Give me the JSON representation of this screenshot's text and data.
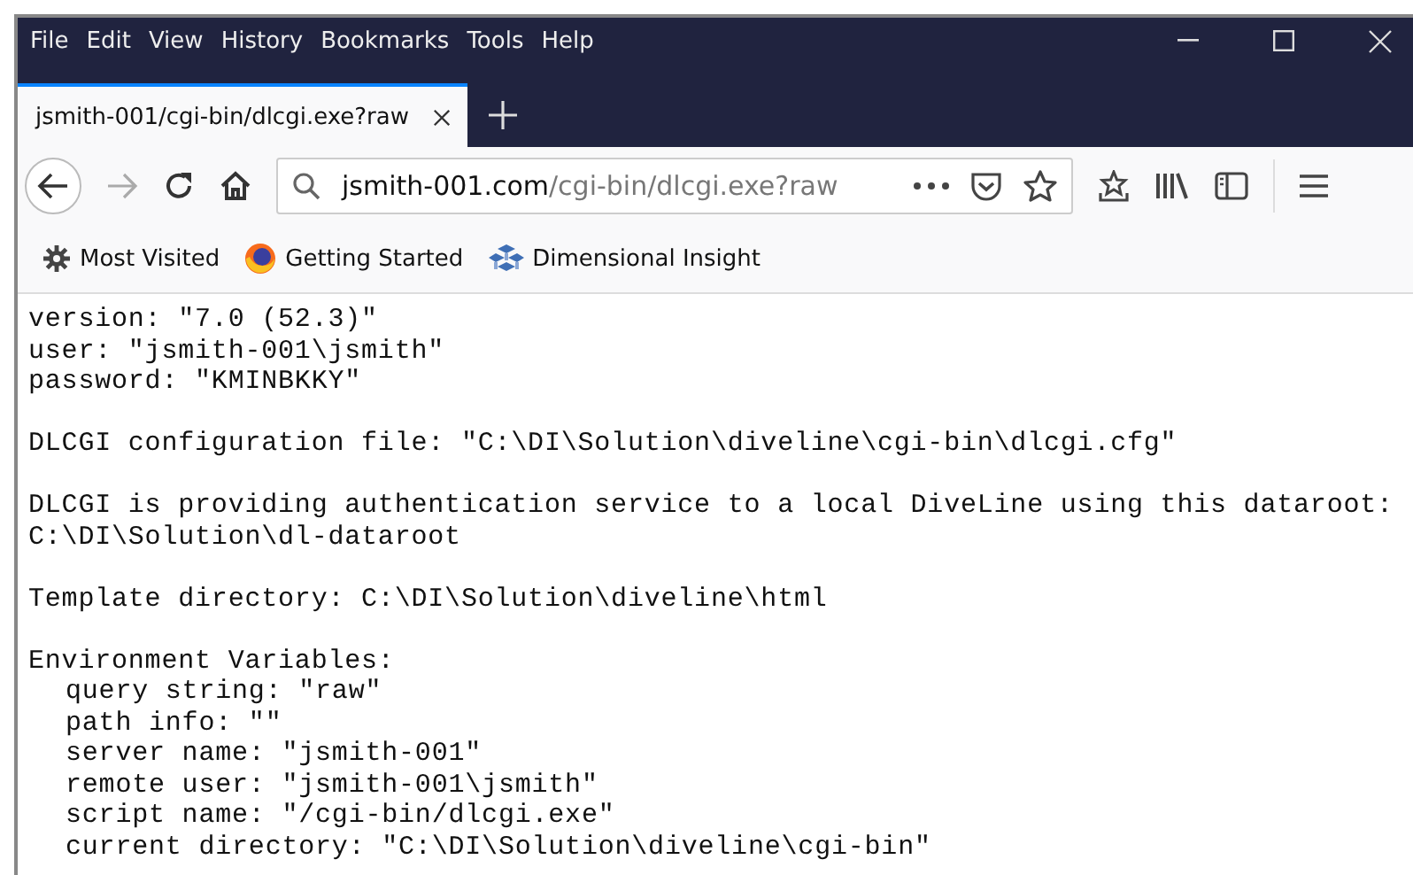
{
  "menu": [
    "File",
    "Edit",
    "View",
    "History",
    "Bookmarks",
    "Tools",
    "Help"
  ],
  "tabs": [
    {
      "label": "jsmith-001/cgi-bin/dlcgi.exe?raw",
      "selected": true
    }
  ],
  "address": {
    "host": "jsmith-001.com",
    "path": "/cgi-bin/dlcgi.exe?raw"
  },
  "bookmarks": [
    {
      "label": "Most Visited",
      "kind": "gear"
    },
    {
      "label": "Getting Started",
      "kind": "firefox"
    },
    {
      "label": "Dimensional Insight",
      "kind": "cubes"
    }
  ],
  "content": {
    "sections": [
      {
        "lines": [
          "version: \"7.0 (52.3)\"",
          "user: \"jsmith-001\\jsmith\"",
          "password: \"KMINBKKY\""
        ]
      },
      {
        "lines": [
          "DLCGI configuration file: \"C:\\DI\\Solution\\diveline\\cgi-bin\\dlcgi.cfg\""
        ]
      },
      {
        "lines": [
          "DLCGI is providing authentication service to a local DiveLine using this dataroot:",
          "C:\\DI\\Solution\\dl-dataroot"
        ]
      },
      {
        "lines": [
          "Template directory: C:\\DI\\Solution\\diveline\\html"
        ]
      },
      {
        "lines": [
          "Environment Variables:"
        ],
        "items": [
          "query string: \"raw\"",
          "path info: \"\"",
          "server name: \"jsmith-001\"",
          "remote user: \"jsmith-001\\jsmith\"",
          "script name: \"/cgi-bin/dlcgi.exe\"",
          "current directory: \"C:\\DI\\Solution\\diveline\\cgi-bin\""
        ]
      }
    ]
  }
}
